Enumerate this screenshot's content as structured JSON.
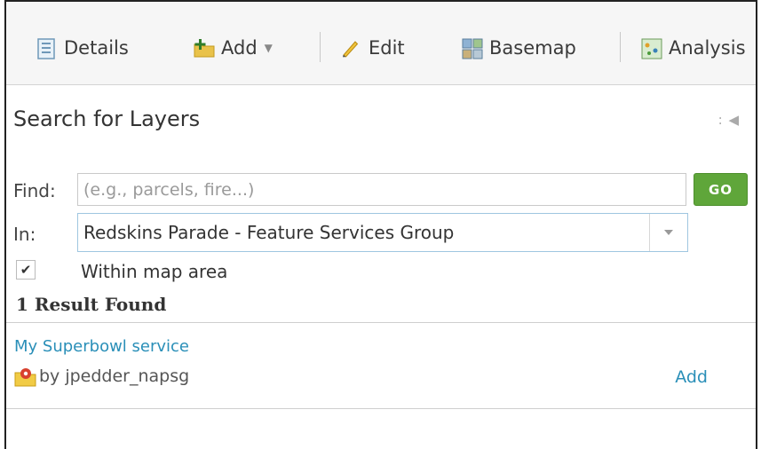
{
  "toolbar": {
    "details": "Details",
    "add": "Add",
    "edit": "Edit",
    "basemap": "Basemap",
    "analysis": "Analysis"
  },
  "panel": {
    "title": "Search for Layers",
    "collapse": ": ◀"
  },
  "search": {
    "find_label": "Find:",
    "find_placeholder": "(e.g., parcels, fire...)",
    "find_value": "",
    "go_label": "GO",
    "in_label": "In:",
    "in_value": "Redskins Parade - Feature Services Group",
    "within_label": "Within map area",
    "within_checked": true
  },
  "results": {
    "count_label": "1 Result Found",
    "items": [
      {
        "title": "My Superbowl service",
        "owner": "by jpedder_napsg",
        "action": "Add"
      }
    ]
  },
  "colors": {
    "go_button": "#5fa63a",
    "link": "#2a8fb8"
  }
}
